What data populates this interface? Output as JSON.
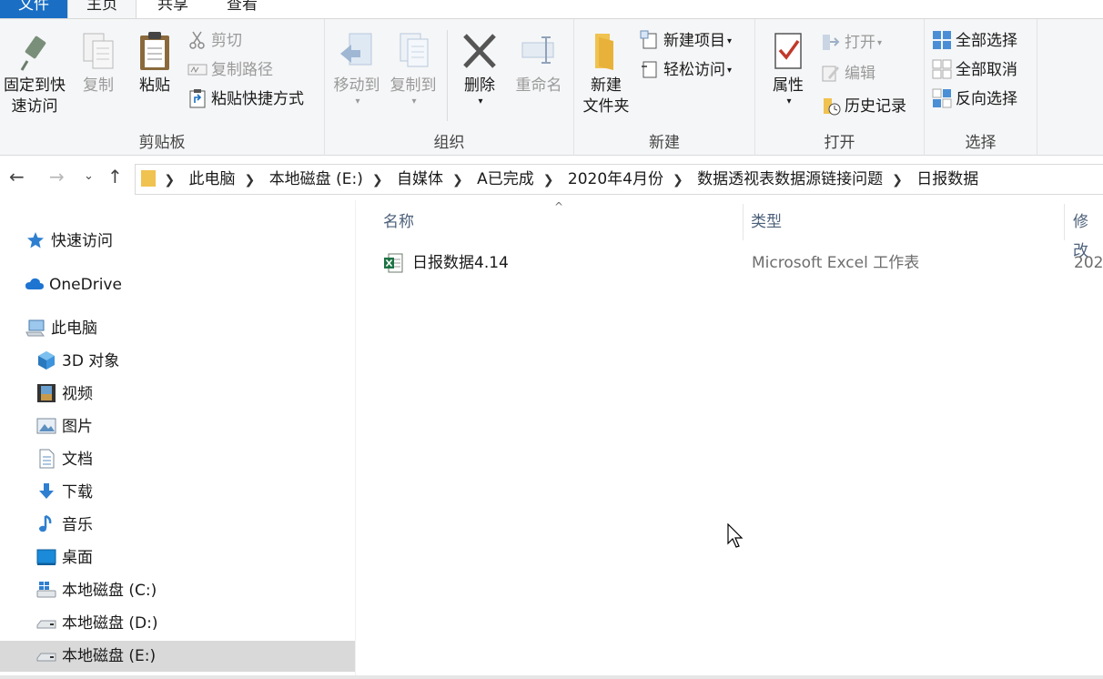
{
  "tabs": {
    "file": "文件",
    "home": "主页",
    "share": "共享",
    "view": "查看"
  },
  "ribbon": {
    "clipboard": {
      "label": "剪贴板",
      "pin": "固定到快速访问",
      "pin_l1": "固定到快",
      "pin_l2": "速访问",
      "copy": "复制",
      "paste": "粘贴",
      "cut": "剪切",
      "copy_path": "复制路径",
      "paste_shortcut": "粘贴快捷方式"
    },
    "organize": {
      "label": "组织",
      "move_to": "移动到",
      "copy_to": "复制到",
      "delete": "删除",
      "rename": "重命名"
    },
    "new": {
      "label": "新建",
      "new_folder_l1": "新建",
      "new_folder_l2": "文件夹",
      "new_item": "新建项目",
      "easy_access": "轻松访问"
    },
    "open": {
      "label": "打开",
      "properties": "属性",
      "open": "打开",
      "edit": "编辑",
      "history": "历史记录"
    },
    "select": {
      "label": "选择",
      "select_all": "全部选择",
      "select_none": "全部取消",
      "invert": "反向选择"
    }
  },
  "address": {
    "crumbs": [
      "此电脑",
      "本地磁盘 (E:)",
      "自媒体",
      "A已完成",
      "2020年4月份",
      "数据透视表数据源链接问题",
      "日报数据"
    ]
  },
  "nav": {
    "quick_access": "快速访问",
    "onedrive": "OneDrive",
    "this_pc": "此电脑",
    "items": [
      "3D 对象",
      "视频",
      "图片",
      "文档",
      "下载",
      "音乐",
      "桌面",
      "本地磁盘 (C:)",
      "本地磁盘 (D:)",
      "本地磁盘 (E:)"
    ]
  },
  "list": {
    "headers": {
      "name": "名称",
      "type": "类型",
      "modified": "修改"
    },
    "rows": [
      {
        "name": "日报数据4.14",
        "type": "Microsoft Excel 工作表",
        "modified": "202"
      }
    ]
  },
  "colors": {
    "accent": "#1a6fc4",
    "selection": "#d9d9d9",
    "ribbon_bg": "#f5f6f7"
  }
}
